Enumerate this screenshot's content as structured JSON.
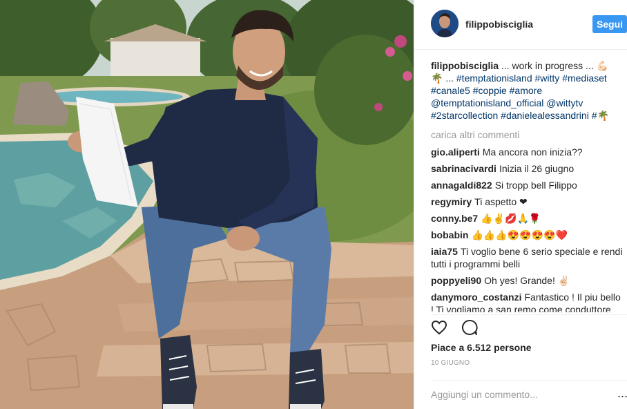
{
  "post": {
    "author": "filippobisciglia",
    "follow_label": "Segui",
    "caption": {
      "author": "filippobisciglia",
      "line1_text": " ... work in progress ... ",
      "line1_emoji": "💪🏻",
      "line2_emoji": "🌴",
      "line2_text": " ... ",
      "hashtags_a": "#temptationisland #witty #mediaset",
      "hashtags_b": "#canale5 #coppie #amore",
      "mention_a": "@temptationisland_official",
      "mention_b": "@wittytv",
      "hashtags_c": "#2starcollection #danielealessandrini",
      "hashtag_end": "#",
      "end_emoji": "🌴"
    },
    "load_more_label": "carica altri commenti",
    "comments": [
      {
        "user": "gio.aliperti",
        "text": "Ma ancora non inizia??"
      },
      {
        "user": "sabrinacivardi",
        "text": "Inizia il 26 giugno"
      },
      {
        "user": "annagaldi822",
        "text": "Si tropp bell Filippo"
      },
      {
        "user": "regymiry",
        "text": "Ti aspetto ❤"
      },
      {
        "user": "conny.be7",
        "text": "👍✌️💋🙏🌹"
      },
      {
        "user": "bobabin",
        "text": "👍👍👍😍😍😍😍❤️"
      },
      {
        "user": "iaia75",
        "text": "Ti voglio bene 6 serio speciale e rendi tutti i programmi belli"
      },
      {
        "user": "poppyeli90",
        "text": "Oh yes! Grande! ✌🏻"
      },
      {
        "user": "danymoro_costanzi",
        "text": "Fantastico ! Il piu bello ! Ti vogliamo a san remo come conduttore"
      }
    ],
    "likes_label": "Piace a 6.512 persone",
    "date_label": "10 giugno",
    "comment_placeholder": "Aggiungi un commento...",
    "more_label": "...",
    "icons": {
      "like": "heart-icon",
      "comment": "comment-bubble-icon"
    }
  }
}
